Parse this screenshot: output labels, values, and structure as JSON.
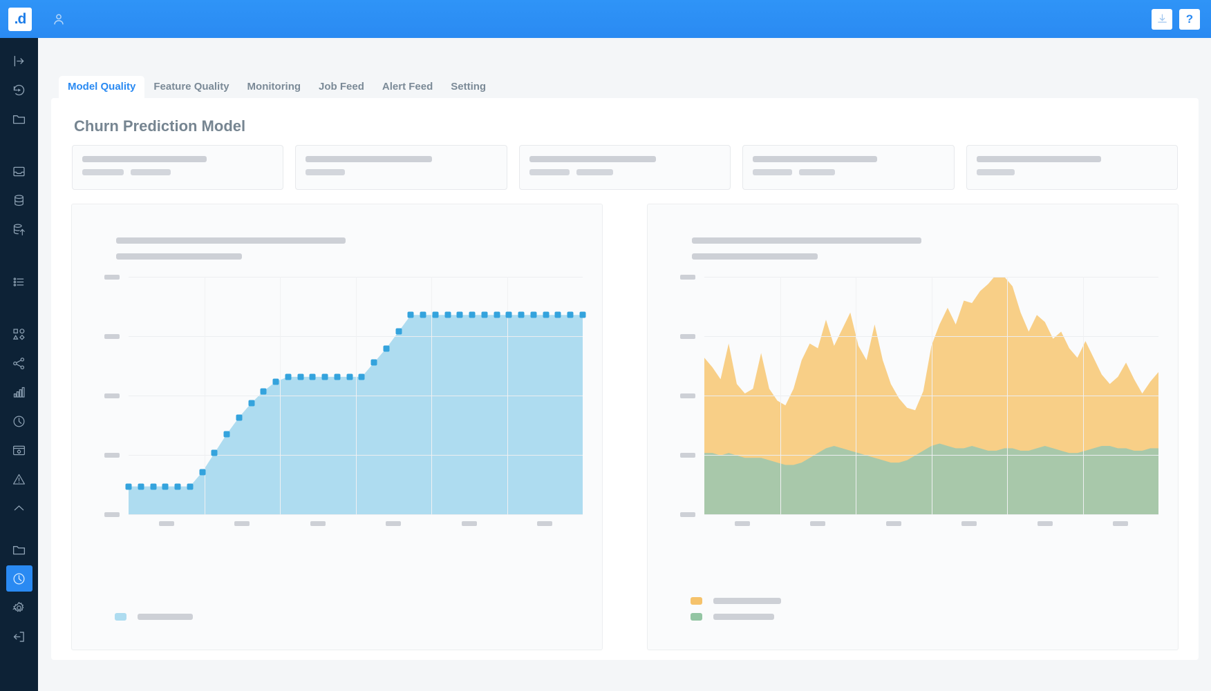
{
  "topbar": {
    "logo_text": ".d",
    "user_icon": "user-avatar-icon",
    "download_icon": "download-icon",
    "help_label": "?",
    "brand_color": "#2a8af2"
  },
  "sidebar": {
    "background": "#0d2236",
    "active_color": "#2a8af2",
    "items": [
      {
        "icon": "collapse-expand-icon",
        "active": false
      },
      {
        "icon": "replay-history-icon",
        "active": false
      },
      {
        "icon": "folder-icon",
        "active": false
      },
      {
        "icon": "inbox-tray-icon",
        "active": false
      },
      {
        "icon": "database-icon",
        "active": false
      },
      {
        "icon": "database-upload-icon",
        "active": false
      },
      {
        "icon": "list-bullets-icon",
        "active": false
      },
      {
        "icon": "shapes-icon",
        "active": false
      },
      {
        "icon": "share-network-icon",
        "active": false
      },
      {
        "icon": "bar-chart-icon",
        "active": false
      },
      {
        "icon": "clock-icon",
        "active": false
      },
      {
        "icon": "browser-settings-icon",
        "active": false
      },
      {
        "icon": "warning-triangle-icon",
        "active": false
      },
      {
        "icon": "chevron-up-icon",
        "active": false
      },
      {
        "icon": "folder-icon",
        "active": false
      },
      {
        "icon": "clock-active-icon",
        "active": true
      },
      {
        "icon": "gear-icon",
        "active": false
      },
      {
        "icon": "logout-icon",
        "active": false
      }
    ]
  },
  "tabs": [
    {
      "label": "Model Quality",
      "active": true
    },
    {
      "label": "Feature Quality",
      "active": false
    },
    {
      "label": "Monitoring",
      "active": false
    },
    {
      "label": "Job Feed",
      "active": false
    },
    {
      "label": "Alert Feed",
      "active": false
    },
    {
      "label": "Setting",
      "active": false
    }
  ],
  "main": {
    "page_title": "Churn Prediction Model",
    "stat_cards": [
      {
        "title_width": 180,
        "chips": [
          60,
          58
        ]
      },
      {
        "title_width": 183,
        "chips": [
          57
        ]
      },
      {
        "title_width": 183,
        "chips": [
          58,
          53
        ]
      },
      {
        "title_width": 180,
        "chips": [
          57,
          52
        ]
      },
      {
        "title_width": 180,
        "chips": [
          55
        ]
      }
    ]
  },
  "chart_data": [
    {
      "type": "area",
      "title": "",
      "subtitle": "",
      "title_skeleton_width": 332,
      "subtitle_skeleton_width": 182,
      "xlabel": "",
      "ylabel": "",
      "grid": true,
      "legend_position": "bottom-left",
      "axis_tick_labels_hidden": true,
      "y_tick_count": 5,
      "x_tick_count": 6,
      "ylim": [
        0,
        100
      ],
      "series": [
        {
          "name": "",
          "legend_skeleton_width": 80,
          "color": "#34a3dd",
          "fill": "#aedcf0",
          "marker": "square",
          "values": [
            12,
            12,
            12,
            12,
            12,
            12,
            18,
            26,
            34,
            41,
            47,
            52,
            56,
            58,
            58,
            58,
            58,
            58,
            58,
            58,
            64,
            70,
            77,
            84,
            84,
            84,
            84,
            84,
            84,
            84,
            84,
            84,
            84,
            84,
            84,
            84,
            84,
            84
          ]
        }
      ]
    },
    {
      "type": "area",
      "title": "",
      "subtitle": "",
      "title_skeleton_width": 332,
      "subtitle_skeleton_width": 182,
      "xlabel": "",
      "ylabel": "",
      "grid": true,
      "legend_position": "bottom-left",
      "axis_tick_labels_hidden": true,
      "stacked": true,
      "y_tick_count": 5,
      "x_tick_count": 6,
      "ylim": [
        0,
        100
      ],
      "series": [
        {
          "name": "",
          "legend_skeleton_width": 98,
          "color": "#f5c26b",
          "fill": "#f8cf87",
          "values": [
            40,
            36,
            32,
            46,
            30,
            27,
            29,
            44,
            30,
            26,
            25,
            32,
            43,
            48,
            44,
            54,
            42,
            50,
            58,
            45,
            40,
            56,
            42,
            33,
            27,
            22,
            19,
            25,
            42,
            50,
            58,
            52,
            62,
            60,
            66,
            70,
            74,
            72,
            68,
            58,
            50,
            56,
            52,
            46,
            50,
            44,
            40,
            46,
            38,
            30,
            26,
            30,
            36,
            30,
            24,
            28,
            32
          ]
        },
        {
          "name": "",
          "legend_skeleton_width": 88,
          "color": "#93c5a3",
          "fill": "#a8c8aa",
          "values": [
            26,
            26,
            25,
            26,
            25,
            24,
            24,
            24,
            23,
            22,
            21,
            21,
            22,
            24,
            26,
            28,
            29,
            28,
            27,
            26,
            25,
            24,
            23,
            22,
            22,
            23,
            25,
            27,
            29,
            30,
            29,
            28,
            28,
            29,
            28,
            27,
            27,
            28,
            28,
            27,
            27,
            28,
            29,
            28,
            27,
            26,
            26,
            27,
            28,
            29,
            29,
            28,
            28,
            27,
            27,
            28,
            28
          ]
        }
      ]
    }
  ]
}
